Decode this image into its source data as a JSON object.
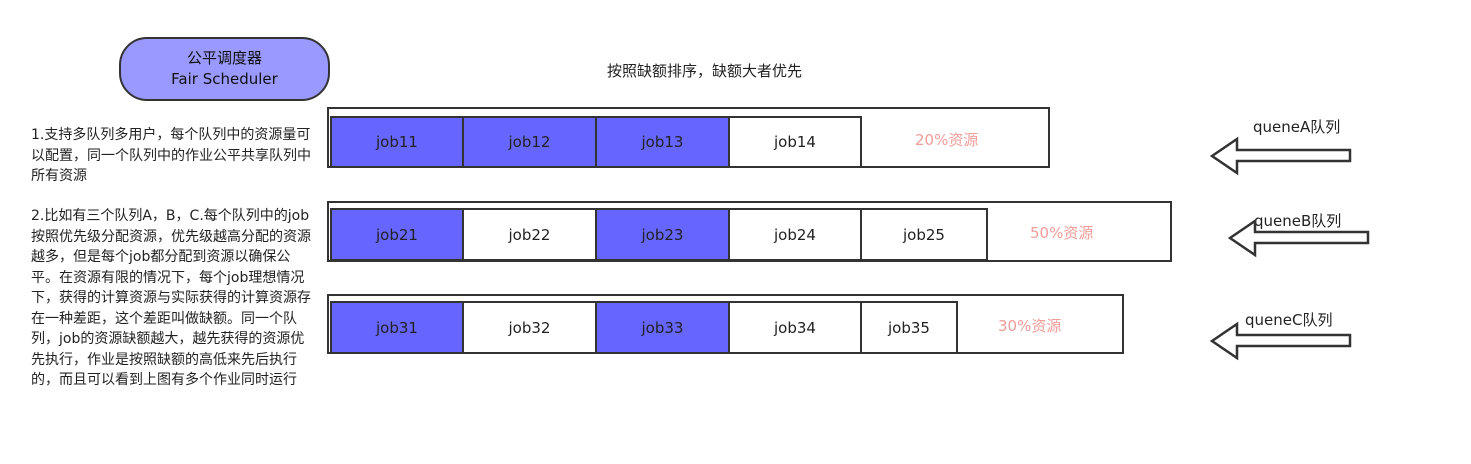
{
  "title": {
    "line1": "公平调度器",
    "line2": "Fair Scheduler"
  },
  "caption": "按照缺额排序，缺额大者优先",
  "description": {
    "point1": "1.支持多队列多用户，每个队列中的资源量可以配置，同一个队列中的作业公平共享队列中所有资源",
    "point2": "2.比如有三个队列A，B，C.每个队列中的job按照优先级分配资源，优先级越高分配的资源越多，但是每个job都分配到资源以确保公平。在资源有限的情况下，每个job理想情况下，获得的计算资源与实际获得的计算资源存在一种差距，这个差距叫做缺额。同一个队列，job的资源缺额越大，越先获得的资源优先执行，作业是按照缺额的高低来先后执行的，而且可以看到上图有多个作业同时运行"
  },
  "colors": {
    "active_job": "#6666ff",
    "idle_job": "#ffffff",
    "resource_text": "#f19c99",
    "title_fill": "#9999ff"
  },
  "queues": [
    {
      "label": "queneA队列",
      "resource": "20%资源",
      "jobs": [
        {
          "name": "job11",
          "active": true
        },
        {
          "name": "job12",
          "active": true
        },
        {
          "name": "job13",
          "active": true
        },
        {
          "name": "job14",
          "active": false
        }
      ]
    },
    {
      "label": "queneB队列",
      "resource": "50%资源",
      "jobs": [
        {
          "name": "job21",
          "active": true
        },
        {
          "name": "job22",
          "active": false
        },
        {
          "name": "job23",
          "active": true
        },
        {
          "name": "job24",
          "active": false
        },
        {
          "name": "job25",
          "active": false
        }
      ]
    },
    {
      "label": "queneC队列",
      "resource": "30%资源",
      "jobs": [
        {
          "name": "job31",
          "active": true
        },
        {
          "name": "job32",
          "active": false
        },
        {
          "name": "job33",
          "active": true
        },
        {
          "name": "job34",
          "active": false
        },
        {
          "name": "job35",
          "active": false
        }
      ]
    }
  ]
}
